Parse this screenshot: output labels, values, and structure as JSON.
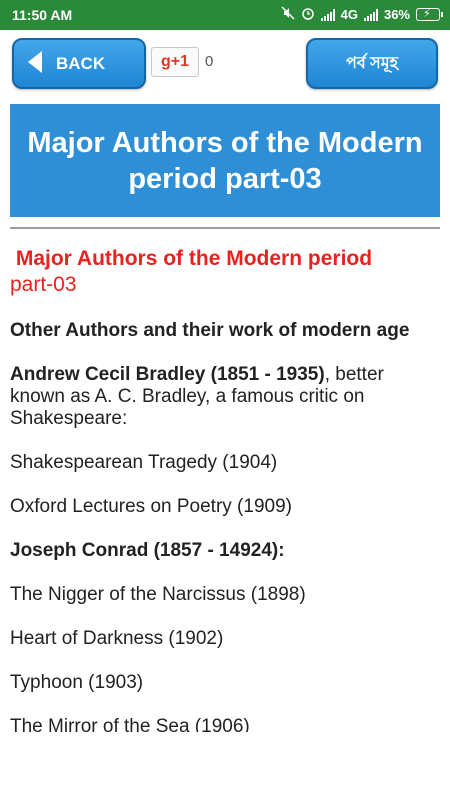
{
  "status": {
    "time": "11:50 AM",
    "network": "4G",
    "battery": "36%"
  },
  "toolbar": {
    "back_label": "BACK",
    "gplus_label": "g+1",
    "gplus_count": "0",
    "parts_label": "পর্ব সমূহ"
  },
  "banner": {
    "title": "Major Authors of the Modern period part-03"
  },
  "content": {
    "heading_bold": "Major Authors of the Modern period",
    "heading_rest": "part-03",
    "subheading": "Other Authors and their work of modern age",
    "author1_name": "Andrew Cecil Bradley (1851 - 1935)",
    "author1_desc": ", better known as A. C. Bradley, a famous critic on Shakespeare:",
    "author1_works": [
      "Shakespearean Tragedy (1904)",
      "Oxford Lectures on Poetry (1909)"
    ],
    "author2_name": "Joseph Conrad (1857 - 14924):",
    "author2_works": [
      "The Nigger of the Narcissus (1898)",
      "Heart of Darkness (1902)",
      "Typhoon (1903)",
      "The Mirror of the Sea (1906)"
    ]
  }
}
